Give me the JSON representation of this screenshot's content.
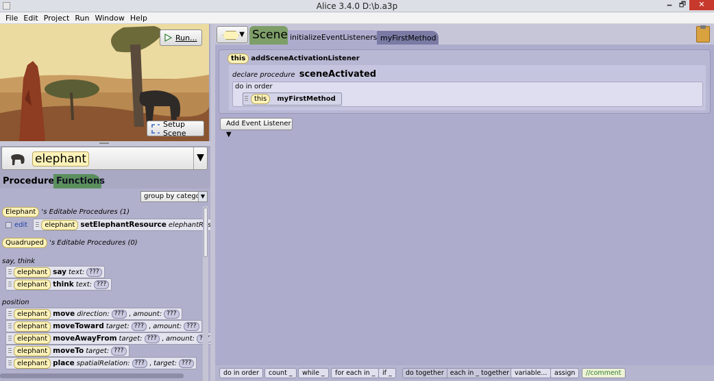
{
  "window": {
    "title": "Alice 3.4.0 D:\\b.a3p",
    "min": "🗕",
    "max": "🗗",
    "close": "✕"
  },
  "menu": [
    "File",
    "Edit",
    "Project",
    "Run",
    "Window",
    "Help"
  ],
  "scene_view": {
    "run_label": "Run...",
    "setup_label": "Setup Scene"
  },
  "selector": {
    "current": "elephant",
    "arrow": "▼"
  },
  "left_tabs": {
    "procedures": "Procedures",
    "functions": "Functions"
  },
  "group_by": {
    "value": "group by category",
    "arrow": "▼"
  },
  "editable": {
    "elephant_type": "Elephant",
    "elephant_suffix": "'s Editable Procedures (1)",
    "edit_label": "edit",
    "proc_owner": "elephant",
    "proc_name": "setElephantResource",
    "proc_param": "elephantResource:",
    "quadruped_type": "Quadruped",
    "quadruped_suffix": "'s Editable Procedures (0)"
  },
  "categories": {
    "say_think": "say, think",
    "position": "position"
  },
  "procedures": [
    {
      "owner": "elephant",
      "name": "say",
      "params": [
        "text: ",
        "???"
      ]
    },
    {
      "owner": "elephant",
      "name": "think",
      "params": [
        "text: ",
        "???"
      ]
    },
    {
      "owner": "elephant",
      "name": "move",
      "params": [
        "direction:",
        "???",
        ",",
        "amount:",
        "???"
      ]
    },
    {
      "owner": "elephant",
      "name": "moveToward",
      "params": [
        "target:",
        "???",
        ",",
        "amount:",
        "???"
      ]
    },
    {
      "owner": "elephant",
      "name": "moveAwayFrom",
      "params": [
        "target:",
        "???",
        ",",
        "amount:",
        "???"
      ]
    },
    {
      "owner": "elephant",
      "name": "moveTo",
      "params": [
        "target:",
        "???"
      ]
    },
    {
      "owner": "elephant",
      "name": "place",
      "params": [
        "spatialRelation:",
        "???",
        ",",
        "target:",
        "???"
      ]
    }
  ],
  "editor": {
    "type_arrow": "▼",
    "scene_tab": "Scene",
    "tab_active": "initializeEventListeners",
    "tab_close": "☒",
    "tab_other": "myFirstMethod",
    "listener_this": "this",
    "listener_name": "addSceneActivationListener",
    "declare_label": "declare procedure",
    "declare_name": "sceneActivated",
    "do_in_order": "do in order",
    "stmt_this": "this",
    "stmt_name": "myFirstMethod",
    "add_listener": "Add Event Listener ▼"
  },
  "bottom_bar": {
    "do_in_order": "do in order",
    "count": "count _",
    "while": "while _",
    "for_each_in": "for each in _",
    "if": "if _",
    "do_together": "do together",
    "each_in_together": "each in _ together",
    "variable": "variable...",
    "assign": "assign",
    "comment": "//comment"
  },
  "colors": {
    "editor_bg": "#adaccd",
    "scene_tab": "#7e9e68",
    "functions_tab": "#5b8f5e",
    "pill": "#fdf2b8"
  }
}
